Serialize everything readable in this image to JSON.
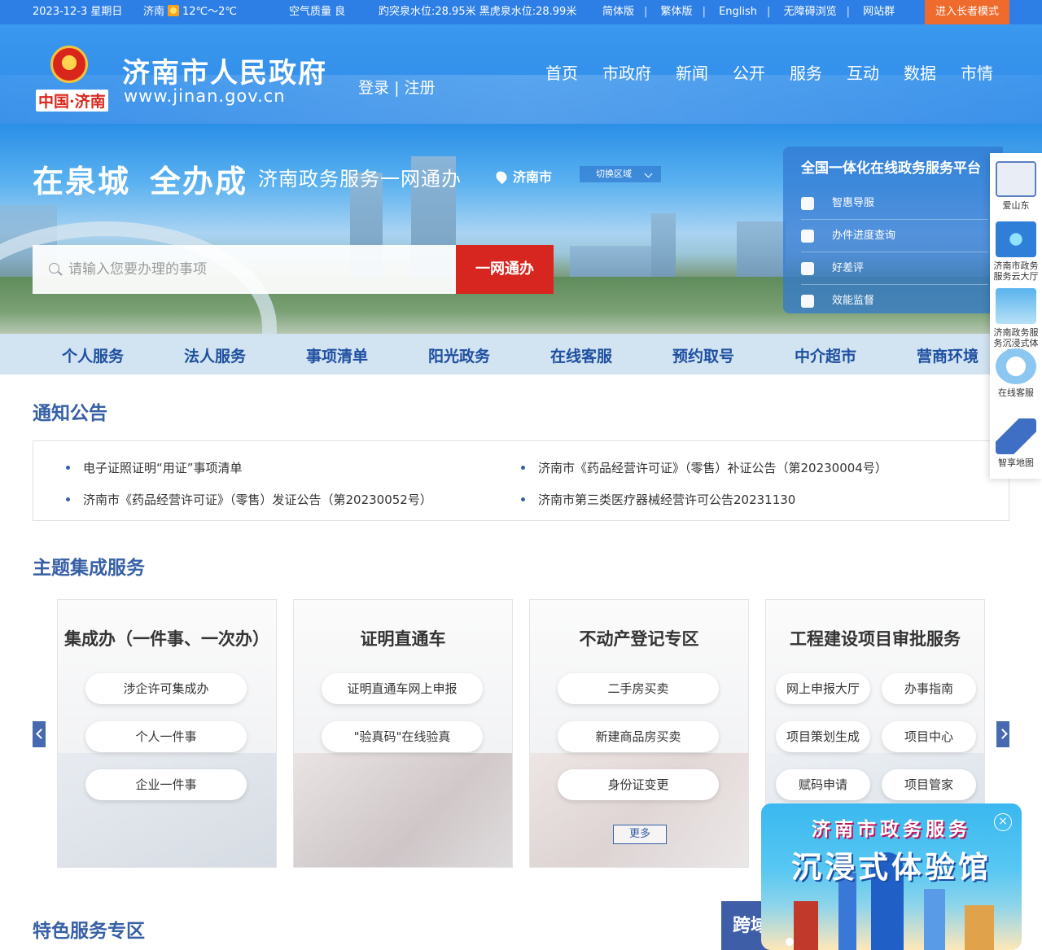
{
  "topbar": {
    "date": "2023-12-3 星期日",
    "city": "济南",
    "temperature": "12℃～2℃",
    "air_quality": "空气质量 良",
    "springs": "趵突泉水位:28.95米 黑虎泉水位:28.99米",
    "links": [
      "简体版",
      "繁体版",
      "English",
      "无障碍浏览",
      "网站群"
    ],
    "elder_mode": "进入长者模式"
  },
  "header": {
    "emblem_text": "中国·济南",
    "title": "济南市人民政府",
    "url": "www.jinan.gov.cn",
    "login": "登录",
    "register": "注册",
    "nav": [
      "首页",
      "市政府",
      "新闻",
      "公开",
      "服务",
      "互动",
      "数据",
      "市情"
    ]
  },
  "banner": {
    "slogan_a": "在泉城",
    "slogan_b": "全办成",
    "slogan_c": "济南政务服务一网通办",
    "location": "济南市",
    "switch_region": "切换区域",
    "search_placeholder": "请输入您要办理的事项",
    "search_button": "一网通办",
    "platform": {
      "title": "全国一体化在线政务服务平台",
      "items": [
        "智惠导服",
        "办件进度查询",
        "好差评",
        "效能监督"
      ]
    }
  },
  "func_nav": [
    "个人服务",
    "法人服务",
    "事项清单",
    "阳光政务",
    "在线客服",
    "预约取号",
    "中介超市",
    "营商环境"
  ],
  "notices": {
    "title": "通知公告",
    "items": [
      "电子证照证明“用证”事项清单",
      "济南市《药品经营许可证》（零售）补证公告（第20230004号）",
      "济南市《药品经营许可证》（零售）发证公告（第20230052号）",
      "济南市第三类医疗器械经营许可公告20231130"
    ]
  },
  "theme": {
    "title": "主题集成服务",
    "cards": [
      {
        "title": "集成办（一件事、一次办）",
        "buttons": [
          "涉企许可集成办",
          "个人一件事",
          "企业一件事"
        ]
      },
      {
        "title": "证明直通车",
        "buttons": [
          "证明直通车网上申报",
          "\"验真码\"在线验真"
        ]
      },
      {
        "title": "不动产登记专区",
        "buttons": [
          "二手房买卖",
          "新建商品房买卖",
          "身份证变更"
        ],
        "more": "更多"
      },
      {
        "title": "工程建设项目审批服务",
        "buttons": [
          "网上申报大厅",
          "办事指南",
          "项目策划生成",
          "项目中心",
          "赋码申请",
          "项目管家"
        ]
      }
    ]
  },
  "sidebar": [
    {
      "label": "爱山东",
      "color": "#e9eef6"
    },
    {
      "label": "济南市政务服务云大厅",
      "color": "#2f7fd8"
    },
    {
      "label": "济南政务服务沉浸式体验馆",
      "color": "#59b3ee"
    },
    {
      "label": "在线客服",
      "color": "#cfe8fb"
    },
    {
      "label": "智享地图",
      "color": "#ffffff"
    }
  ],
  "features": {
    "title": "特色服务专区",
    "tab": "跨域"
  },
  "popup": {
    "line1": "济南市政务服务",
    "line2": "沉浸式体验馆"
  }
}
